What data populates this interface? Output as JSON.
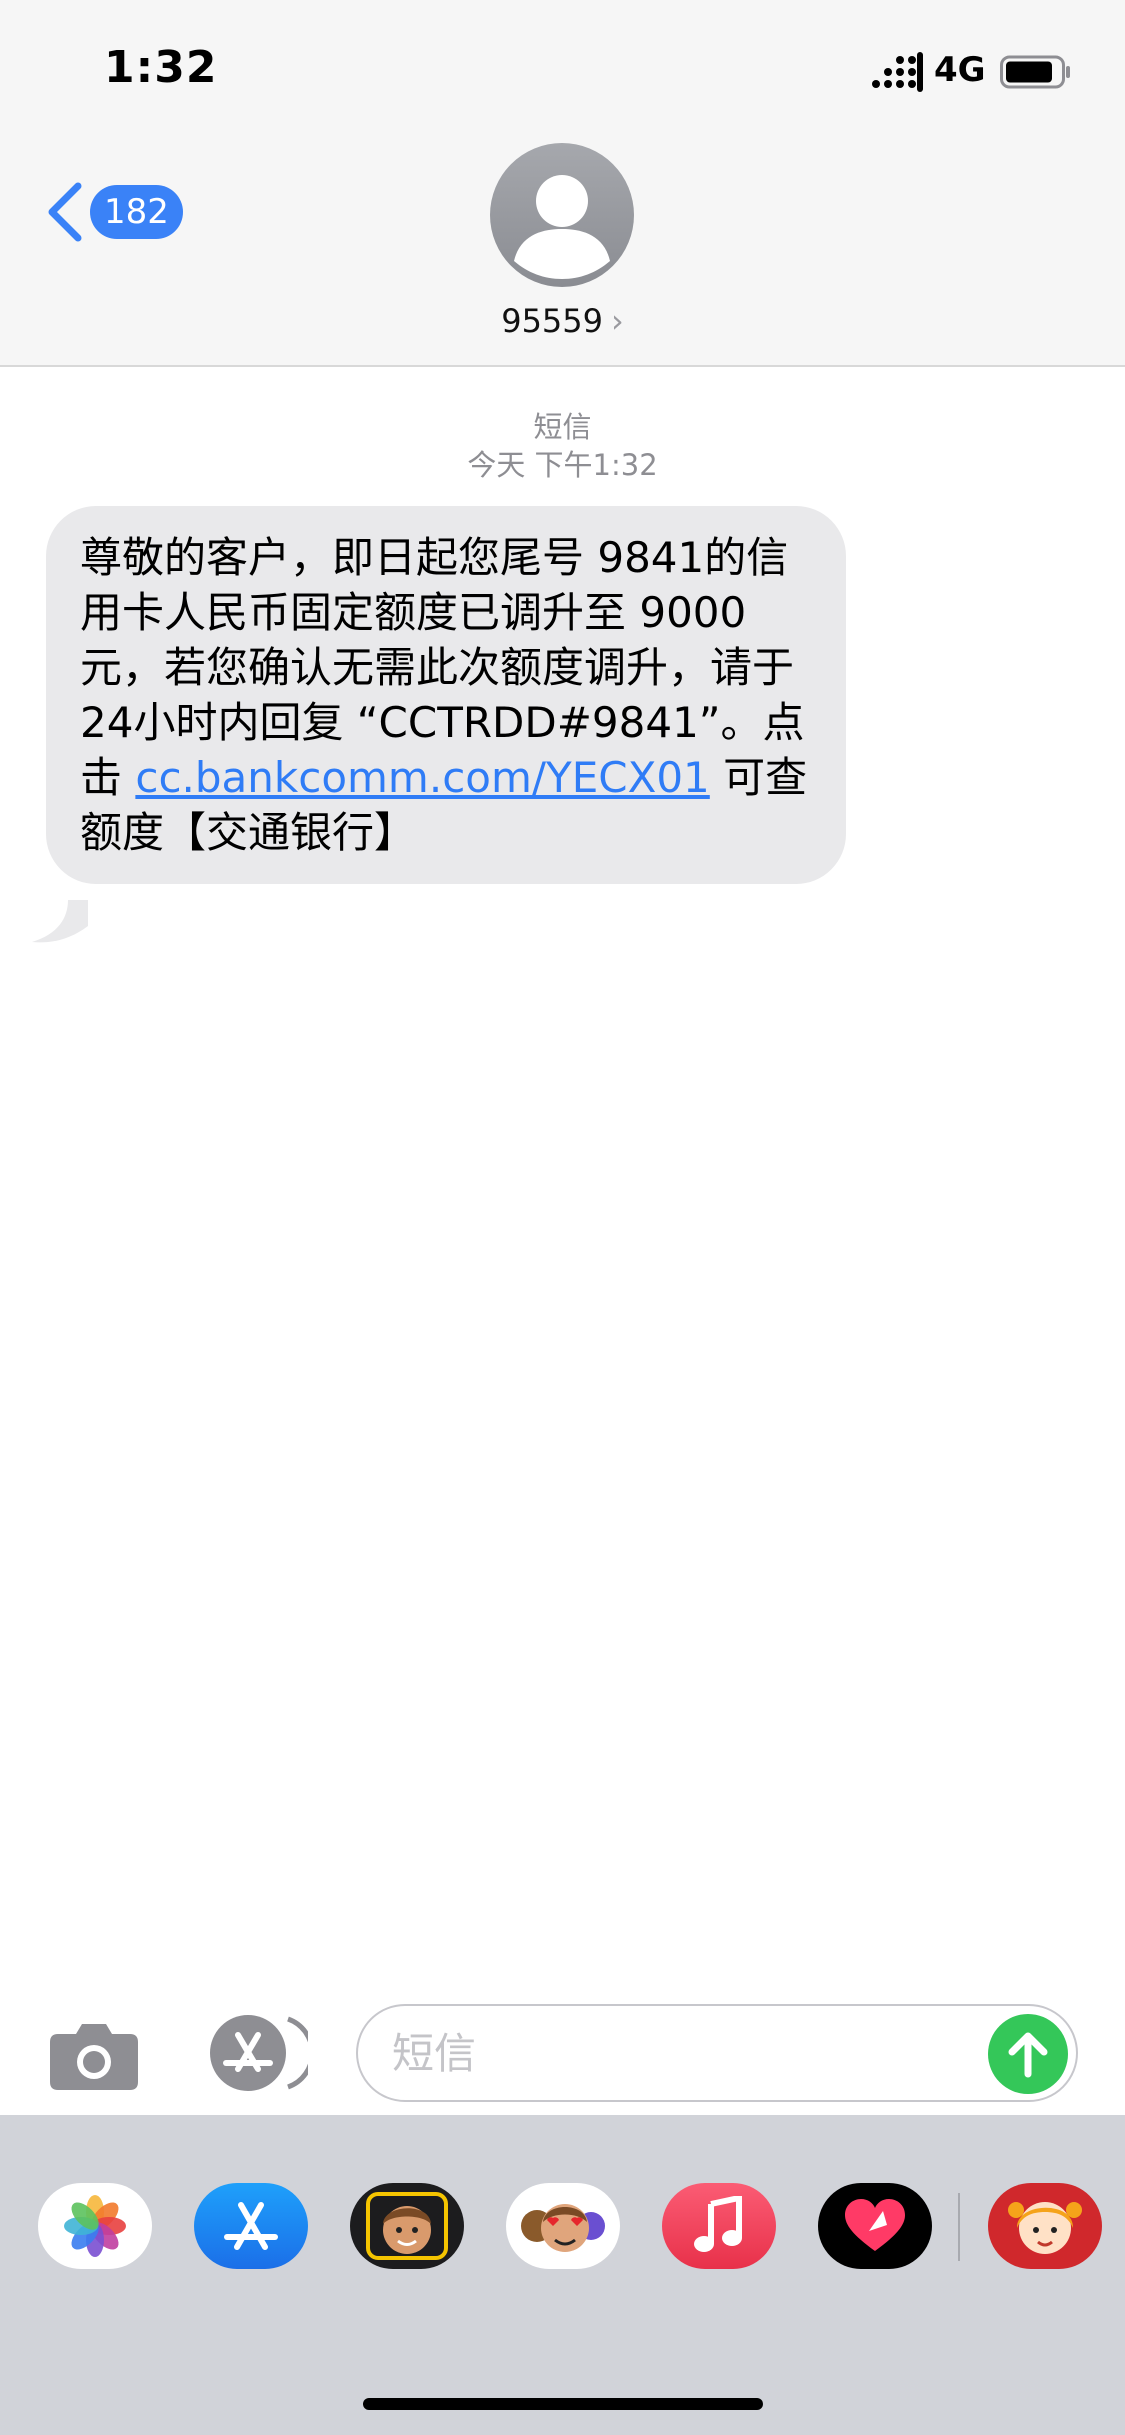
{
  "status_bar": {
    "time": "1:32",
    "network": "4G"
  },
  "nav": {
    "back_count": "182",
    "contact": "95559",
    "contact_chevron": "›"
  },
  "conversation": {
    "kind": "短信",
    "timestamp": "今天 下午1:32",
    "message": {
      "text_before_link": "尊敬的客户，即日起您尾号 9841的信用卡人民币固定额度已调升至 9000元，若您确认无需此次额度调升，请于 24小时内回复 “CCTRDD#9841”。点击 ",
      "link": "cc.bankcomm.com/YECX01",
      "text_after_link": " 可查额度【交通银行】"
    }
  },
  "composer": {
    "placeholder": "短信"
  },
  "drawer": {
    "apps": [
      "photos-icon",
      "app-store-icon",
      "memoji-icon",
      "animoji-icon",
      "music-icon",
      "digital-touch-icon",
      "sticker-app-icon"
    ]
  },
  "colors": {
    "accent": "#3a82f7",
    "send": "#34c759",
    "bubble": "#e9e9eb",
    "link": "#2f7cf6"
  }
}
